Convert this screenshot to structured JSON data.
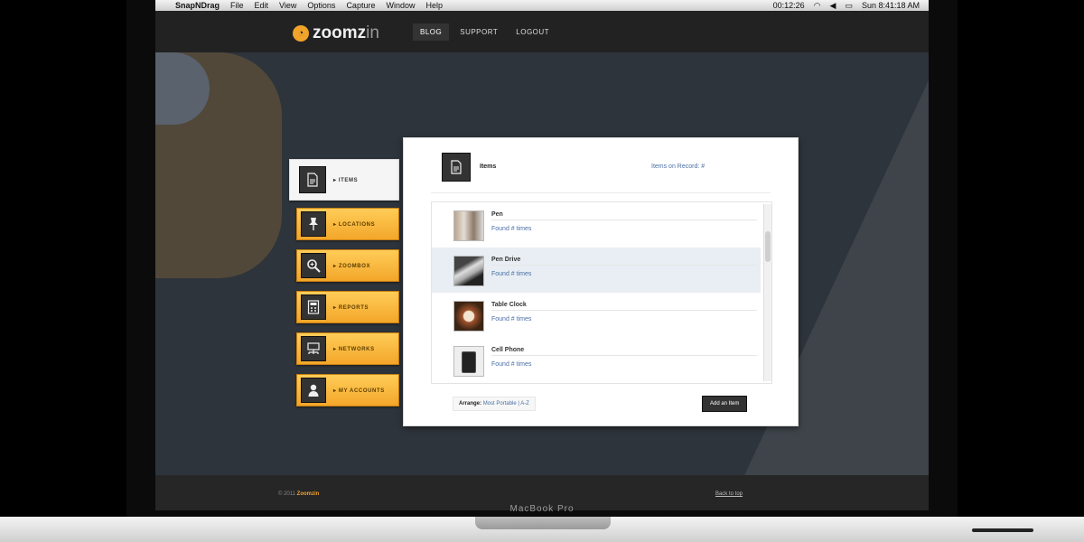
{
  "menubar": {
    "app_name": "SnapNDrag",
    "items": [
      "File",
      "Edit",
      "View",
      "Options",
      "Capture",
      "Window",
      "Help"
    ],
    "status": {
      "time_display": "00:12:26",
      "clock": "Sun 8:41:18 AM"
    }
  },
  "site": {
    "logo_main": "zoomz",
    "logo_suffix": "in",
    "nav": [
      "BLOG",
      "SUPPORT",
      "LOGOUT"
    ]
  },
  "sidemenu": [
    {
      "label": "▸ ITEMS",
      "icon": "document-icon",
      "active": true
    },
    {
      "label": "▸ LOCATIONS",
      "icon": "pushpin-icon"
    },
    {
      "label": "▸ ZOOMBOX",
      "icon": "magnifier-icon"
    },
    {
      "label": "▸ REPORTS",
      "icon": "calculator-icon"
    },
    {
      "label": "▸ NETWORKS",
      "icon": "network-icon"
    },
    {
      "label": "▸ MY ACCOUNTS",
      "icon": "user-icon"
    }
  ],
  "panel": {
    "title": "Items",
    "records_link": "Items on Record: #",
    "items": [
      {
        "name": "Pen",
        "found": "Found # times"
      },
      {
        "name": "Pen Drive",
        "found": "Found # times",
        "selected": true
      },
      {
        "name": "Table Clock",
        "found": "Found # times"
      },
      {
        "name": "Cell Phone",
        "found": "Found # times"
      }
    ],
    "arrange_label": "Arrange:",
    "arrange_options": "Most Portable | A-Z",
    "add_button": "Add an Item"
  },
  "footer": {
    "copyright": "© 2011",
    "brand": "Zoomzin",
    "back_to_top": "Back to top"
  },
  "laptop": {
    "model_label": "MacBook Pro"
  },
  "colors": {
    "accent": "#f2a32a",
    "link": "#4a6fa5",
    "nav_bg": "#222222",
    "screen_bg": "#2e343b"
  }
}
